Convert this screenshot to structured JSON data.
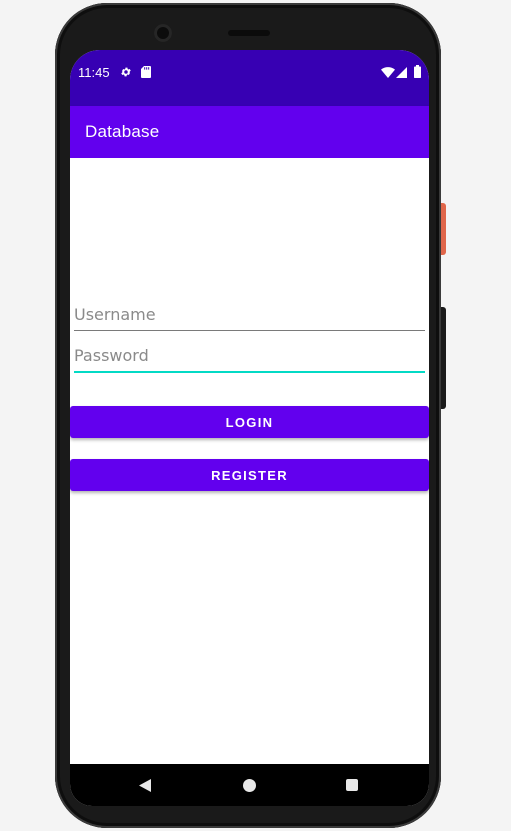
{
  "status_bar": {
    "time": "11:45",
    "icons": [
      "gear-icon",
      "sd-card-icon",
      "wifi-icon",
      "signal-icon",
      "battery-icon"
    ],
    "background": "#3700b3"
  },
  "app_bar": {
    "title": "Database",
    "background": "#6200ee"
  },
  "form": {
    "username": {
      "value": "",
      "placeholder": "Username"
    },
    "password": {
      "value": "",
      "placeholder": "Password"
    },
    "login_label": "LOGIN",
    "register_label": "REGISTER",
    "accent": "#03dac5",
    "button_color": "#6200ee"
  },
  "nav_bar": {
    "icons": [
      "back-icon",
      "home-icon",
      "recents-icon"
    ]
  }
}
